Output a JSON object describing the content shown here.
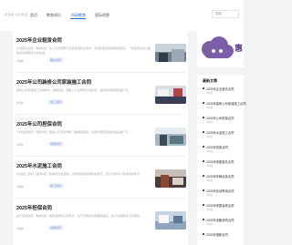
{
  "header": {
    "logo_text": "律法库·合同频道",
    "nav": [
      "首页",
      "教育知识",
      "科研教育",
      "国际视野"
    ],
    "search_placeholder": "搜索..."
  },
  "articles": [
    {
      "title": "2025年企业租赁合同",
      "excerpt": "企业租赁合同（精选5篇）在人们法律意识日益增强的社会中，合同的使用频率越来越高，一份合同的签订能够有效保障双方的权益。",
      "meta": "3年前",
      "tag": "租赁合同"
    },
    {
      "title": "2025年公司装修公司家装施工合同",
      "excerpt": "装修公司家装施工合同样本（精选5篇）随着人们法律意识的提高，合同的使用越来越广泛。",
      "meta": "3年前",
      "tag": "施工合同"
    },
    {
      "title": "2025年公司担保合同",
      "excerpt": "公司担保合同（通用5篇）随着人们对法律的了解越来越深，合同的使用范围也越来越广泛。",
      "meta": "3年前",
      "tag": "担保合同"
    },
    {
      "title": "2025年水泥施工合同",
      "excerpt": "水泥施工合同（通用5篇）随着时代的发展，合同的使用频率越来越高，签订合同可以有效保护双方。",
      "meta": "3年前",
      "tag": "施工合同"
    },
    {
      "title": "2025年担保合同",
      "excerpt": "关于担保合同（精选5篇）随着法律知识的普及，关于合同的问题越来越多，签订合同前须认真审阅。",
      "meta": "3年前",
      "tag": "担保合同"
    }
  ],
  "sidebar": {
    "logo_text": "惠",
    "heading": "最新文章",
    "items": [
      {
        "title": "2025年企业租赁合同",
        "date": "3年前"
      },
      {
        "title": "2025年装修公司家装施工合同",
        "date": "3年前"
      },
      {
        "title": "2025年公司担保合同",
        "date": "3年前"
      },
      {
        "title": "2025年水泥施工合同",
        "date": "3年前"
      },
      {
        "title": "2025年担保合同",
        "date": "3年前"
      },
      {
        "title": "2025年房屋租赁合同",
        "date": "3年前"
      },
      {
        "title": "2025年车辆买卖合同",
        "date": "3年前"
      },
      {
        "title": "2025年劳动聘用合同",
        "date": "3年前"
      },
      {
        "title": "2025年房屋装修合同",
        "date": "3年前"
      },
      {
        "title": "2025年设备采购合同",
        "date": "3年前"
      },
      {
        "title": "2025年借款合同",
        "date": "3年前"
      }
    ]
  },
  "colors": {
    "accent": "#1e6fd9",
    "brand": "#7b5ea7",
    "tag_bg": "#eef2fb"
  }
}
